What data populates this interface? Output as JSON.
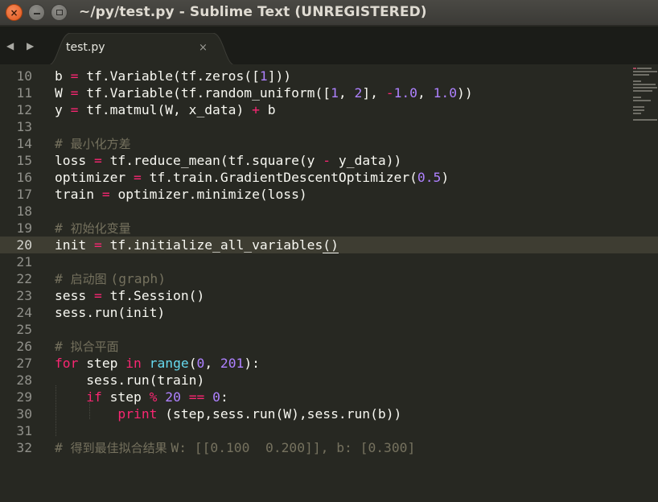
{
  "window": {
    "title": "~/py/test.py - Sublime Text (UNREGISTERED)",
    "close_glyph": "×",
    "nav_arrows": "◀ ▶"
  },
  "tab": {
    "label": "test.py",
    "close_glyph": "×"
  },
  "editor": {
    "active_line": 20,
    "colors": {
      "background": "#272822",
      "keyword": "#f92672",
      "number": "#ae81ff",
      "builtin": "#66d9ef",
      "comment": "#75715e",
      "text": "#f8f8f2"
    },
    "lines": [
      {
        "num": "10",
        "tokens": [
          [
            "n",
            "b "
          ],
          [
            "op",
            "="
          ],
          [
            "n",
            " tf.Variable(tf.zeros(["
          ],
          [
            "num",
            "1"
          ],
          [
            "n",
            "]))"
          ]
        ]
      },
      {
        "num": "11",
        "tokens": [
          [
            "n",
            "W "
          ],
          [
            "op",
            "="
          ],
          [
            "n",
            " tf.Variable(tf.random_uniform(["
          ],
          [
            "num",
            "1"
          ],
          [
            "n",
            ", "
          ],
          [
            "num",
            "2"
          ],
          [
            "n",
            "], "
          ],
          [
            "op",
            "-"
          ],
          [
            "num",
            "1.0"
          ],
          [
            "n",
            ", "
          ],
          [
            "num",
            "1.0"
          ],
          [
            "n",
            "))"
          ]
        ]
      },
      {
        "num": "12",
        "tokens": [
          [
            "n",
            "y "
          ],
          [
            "op",
            "="
          ],
          [
            "n",
            " tf.matmul(W, x_data) "
          ],
          [
            "op",
            "+"
          ],
          [
            "n",
            " b"
          ]
        ]
      },
      {
        "num": "13",
        "tokens": []
      },
      {
        "num": "14",
        "tokens": [
          [
            "cm",
            "# "
          ],
          [
            "cmz",
            "最小化方差"
          ]
        ]
      },
      {
        "num": "15",
        "tokens": [
          [
            "n",
            "loss "
          ],
          [
            "op",
            "="
          ],
          [
            "n",
            " tf.reduce_mean(tf.square(y "
          ],
          [
            "op",
            "-"
          ],
          [
            "n",
            " y_data))"
          ]
        ]
      },
      {
        "num": "16",
        "tokens": [
          [
            "n",
            "optimizer "
          ],
          [
            "op",
            "="
          ],
          [
            "n",
            " tf.train.GradientDescentOptimizer("
          ],
          [
            "num",
            "0.5"
          ],
          [
            "n",
            ")"
          ]
        ]
      },
      {
        "num": "17",
        "tokens": [
          [
            "n",
            "train "
          ],
          [
            "op",
            "="
          ],
          [
            "n",
            " optimizer.minimize(loss)"
          ]
        ]
      },
      {
        "num": "18",
        "tokens": []
      },
      {
        "num": "19",
        "tokens": [
          [
            "cm",
            "# "
          ],
          [
            "cmz",
            "初始化变量"
          ]
        ]
      },
      {
        "num": "20",
        "tokens": [
          [
            "n",
            "init "
          ],
          [
            "op",
            "="
          ],
          [
            "n",
            " tf.initialize_all_variables"
          ],
          [
            "u",
            "()"
          ]
        ]
      },
      {
        "num": "21",
        "tokens": []
      },
      {
        "num": "22",
        "tokens": [
          [
            "cm",
            "# "
          ],
          [
            "cmz",
            "启动图 "
          ],
          [
            "cm",
            "(graph)"
          ]
        ]
      },
      {
        "num": "23",
        "tokens": [
          [
            "n",
            "sess "
          ],
          [
            "op",
            "="
          ],
          [
            "n",
            " tf.Session()"
          ]
        ]
      },
      {
        "num": "24",
        "tokens": [
          [
            "n",
            "sess.run(init)"
          ]
        ]
      },
      {
        "num": "25",
        "tokens": []
      },
      {
        "num": "26",
        "tokens": [
          [
            "cm",
            "# "
          ],
          [
            "cmz",
            "拟合平面"
          ]
        ]
      },
      {
        "num": "27",
        "tokens": [
          [
            "kw",
            "for"
          ],
          [
            "n",
            " step "
          ],
          [
            "kw",
            "in"
          ],
          [
            "n",
            " "
          ],
          [
            "bi",
            "range"
          ],
          [
            "n",
            "("
          ],
          [
            "num",
            "0"
          ],
          [
            "n",
            ", "
          ],
          [
            "num",
            "201"
          ],
          [
            "n",
            "):"
          ]
        ]
      },
      {
        "num": "28",
        "tokens": [
          [
            "n",
            "    sess.run(train)"
          ]
        ]
      },
      {
        "num": "29",
        "tokens": [
          [
            "n",
            "    "
          ],
          [
            "kw",
            "if"
          ],
          [
            "n",
            " step "
          ],
          [
            "op",
            "%"
          ],
          [
            "n",
            " "
          ],
          [
            "num",
            "20"
          ],
          [
            "n",
            " "
          ],
          [
            "op",
            "=="
          ],
          [
            "n",
            " "
          ],
          [
            "num",
            "0"
          ],
          [
            "n",
            ":"
          ]
        ]
      },
      {
        "num": "30",
        "tokens": [
          [
            "n",
            "        "
          ],
          [
            "kw",
            "print"
          ],
          [
            "n",
            " (step,sess.run(W),sess.run(b))"
          ]
        ]
      },
      {
        "num": "31",
        "tokens": []
      },
      {
        "num": "32",
        "tokens": [
          [
            "cm",
            "# "
          ],
          [
            "cmz",
            "得到最佳拟合结果 "
          ],
          [
            "cm",
            "W: [[0.100  0.200]], b: [0.300]"
          ]
        ]
      }
    ]
  }
}
